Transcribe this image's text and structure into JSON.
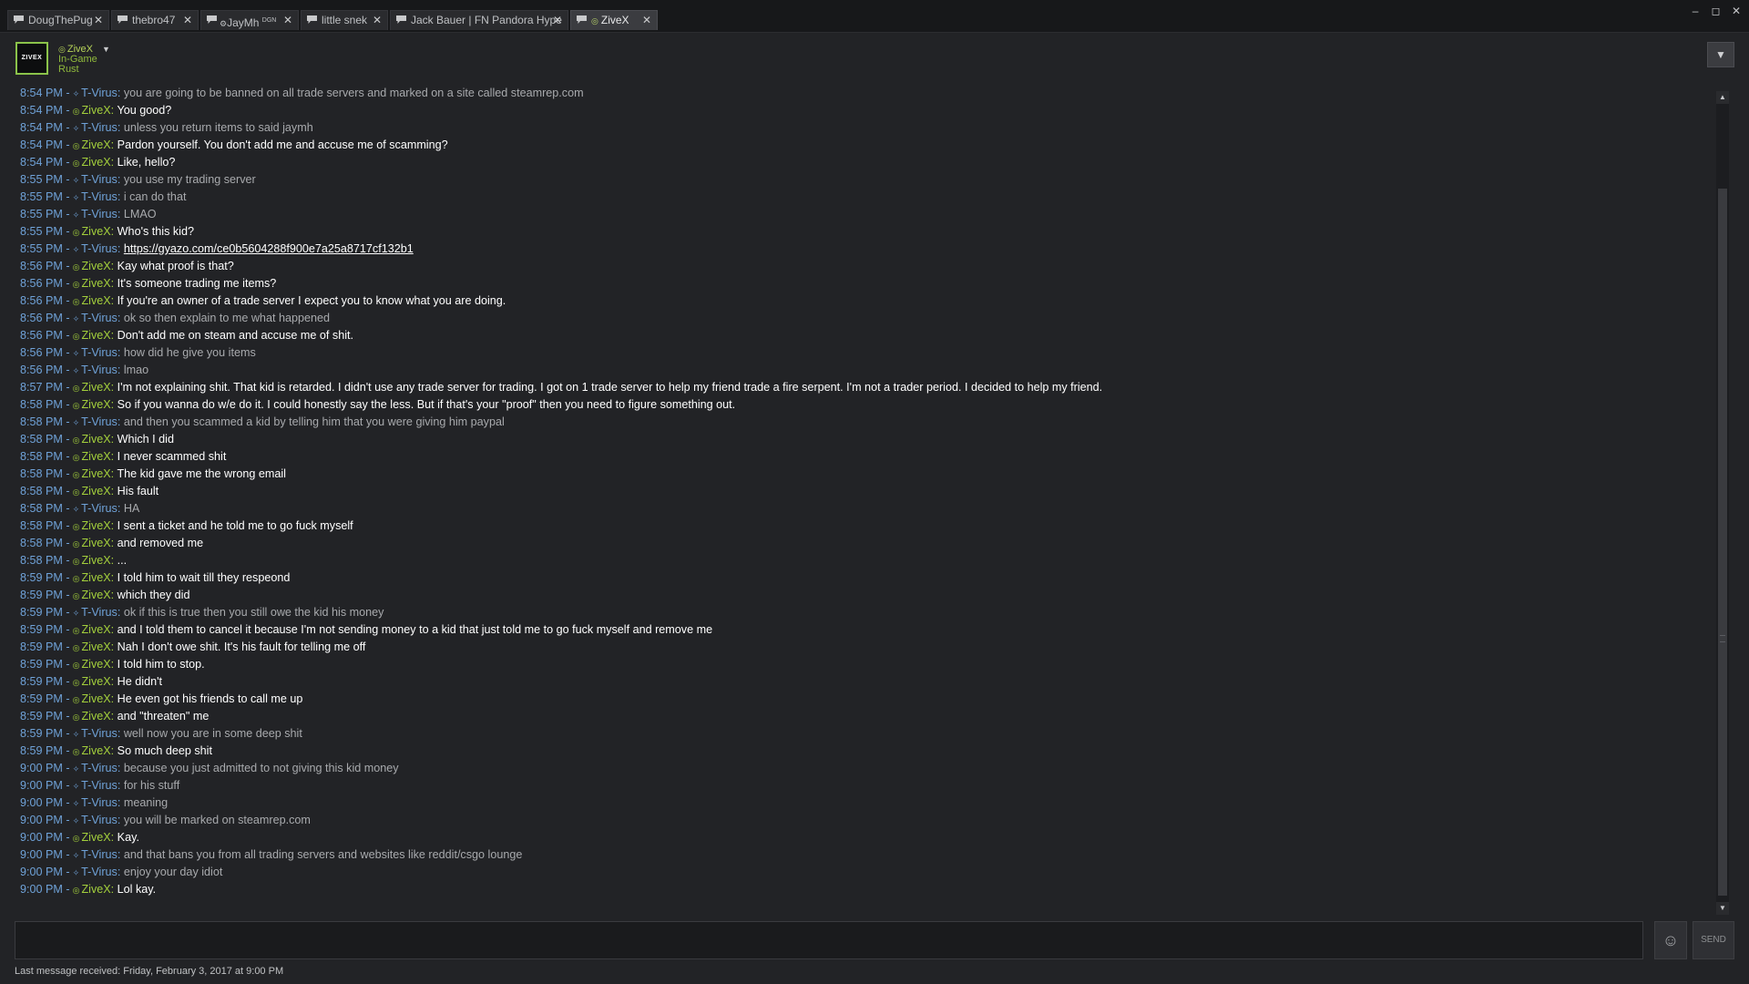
{
  "tabs": [
    {
      "label": "DougThePug",
      "active": false
    },
    {
      "label": "thebro47",
      "active": false
    },
    {
      "label": "JayMh",
      "suffix": "DGN",
      "active": false,
      "has_status": true
    },
    {
      "label": "little snek",
      "active": false
    },
    {
      "label": "Jack Bauer | FN Pandora Hype",
      "active": false
    },
    {
      "label": "ZiveX",
      "active": true,
      "has_status": true
    }
  ],
  "window_controls": {
    "minimize": "–",
    "maximize": "◻",
    "close": "✕"
  },
  "friend": {
    "avatar_text": "ZIVEX",
    "name": "ZiveX",
    "status": "In-Game",
    "game": "Rust"
  },
  "icons": {
    "tab_icon": "chat-bubble-icon",
    "status_icon": "online-status-icon",
    "t_virus_icon": "sparkle-icon",
    "scroll_up": "▲",
    "scroll_down": "▼",
    "dropdown": "▼",
    "emoticon": "☺"
  },
  "colors": {
    "timestamp": "#6fa2d8",
    "t_virus": "#6fa2d8",
    "zivex": "#a3cf3c",
    "ingame_green": "#90ba3c"
  },
  "messages": [
    {
      "time": "8:54 PM",
      "sender": "T-Virus",
      "text": "you are going to be banned on all trade servers and marked on a site called steamrep.com"
    },
    {
      "time": "8:54 PM",
      "sender": "ZiveX",
      "text": "You good?"
    },
    {
      "time": "8:54 PM",
      "sender": "T-Virus",
      "text": "unless you return items to said jaymh"
    },
    {
      "time": "8:54 PM",
      "sender": "ZiveX",
      "text": "Pardon yourself. You don't add me and accuse me of scamming?"
    },
    {
      "time": "8:54 PM",
      "sender": "ZiveX",
      "text": "Like, hello?"
    },
    {
      "time": "8:55 PM",
      "sender": "T-Virus",
      "text": "you use my trading server"
    },
    {
      "time": "8:55 PM",
      "sender": "T-Virus",
      "text": "i can do that"
    },
    {
      "time": "8:55 PM",
      "sender": "T-Virus",
      "text": "LMAO"
    },
    {
      "time": "8:55 PM",
      "sender": "ZiveX",
      "text": "Who's this kid?"
    },
    {
      "time": "8:55 PM",
      "sender": "T-Virus",
      "text": "https://gyazo.com/ce0b5604288f900e7a25a8717cf132b1",
      "link": true
    },
    {
      "time": "8:56 PM",
      "sender": "ZiveX",
      "text": "Kay what proof is that?"
    },
    {
      "time": "8:56 PM",
      "sender": "ZiveX",
      "text": "It's someone trading me items?"
    },
    {
      "time": "8:56 PM",
      "sender": "ZiveX",
      "text": "If you're an owner of a trade server I expect you to know what you are doing."
    },
    {
      "time": "8:56 PM",
      "sender": "T-Virus",
      "text": "ok so then explain to me what happened"
    },
    {
      "time": "8:56 PM",
      "sender": "ZiveX",
      "text": "Don't add me on steam and accuse me of shit."
    },
    {
      "time": "8:56 PM",
      "sender": "T-Virus",
      "text": "how did he give you items"
    },
    {
      "time": "8:56 PM",
      "sender": "T-Virus",
      "text": "lmao"
    },
    {
      "time": "8:57 PM",
      "sender": "ZiveX",
      "text": "I'm not explaining shit. That kid is retarded. I didn't use any trade server for trading. I got on 1 trade server to help my friend trade a fire serpent. I'm not a trader period. I decided to help my friend."
    },
    {
      "time": "8:58 PM",
      "sender": "ZiveX",
      "text": "So if you wanna do w/e do it. I could honestly say the less. But if that's your \"proof\" then you need to figure something out."
    },
    {
      "time": "8:58 PM",
      "sender": "T-Virus",
      "text": "and then you scammed a kid by telling him that you were giving him paypal"
    },
    {
      "time": "8:58 PM",
      "sender": "ZiveX",
      "text": "Which I did"
    },
    {
      "time": "8:58 PM",
      "sender": "ZiveX",
      "text": "I never scammed shit"
    },
    {
      "time": "8:58 PM",
      "sender": "ZiveX",
      "text": "The kid gave me the wrong email"
    },
    {
      "time": "8:58 PM",
      "sender": "ZiveX",
      "text": "His fault"
    },
    {
      "time": "8:58 PM",
      "sender": "T-Virus",
      "text": "HA"
    },
    {
      "time": "8:58 PM",
      "sender": "ZiveX",
      "text": "I sent a ticket and he told me to go fuck myself"
    },
    {
      "time": "8:58 PM",
      "sender": "ZiveX",
      "text": "and removed me"
    },
    {
      "time": "8:58 PM",
      "sender": "ZiveX",
      "text": "..."
    },
    {
      "time": "8:59 PM",
      "sender": "ZiveX",
      "text": "I told him to wait till they respeond"
    },
    {
      "time": "8:59 PM",
      "sender": "ZiveX",
      "text": "which they did"
    },
    {
      "time": "8:59 PM",
      "sender": "T-Virus",
      "text": "ok if this is true then you still owe the kid his money"
    },
    {
      "time": "8:59 PM",
      "sender": "ZiveX",
      "text": "and I told them to cancel it because I'm not sending money to a kid that just told me to go fuck myself and remove me"
    },
    {
      "time": "8:59 PM",
      "sender": "ZiveX",
      "text": "Nah I don't owe shit. It's his fault for telling me off"
    },
    {
      "time": "8:59 PM",
      "sender": "ZiveX",
      "text": "I told him to stop."
    },
    {
      "time": "8:59 PM",
      "sender": "ZiveX",
      "text": "He didn't"
    },
    {
      "time": "8:59 PM",
      "sender": "ZiveX",
      "text": "He even got his friends to call me up"
    },
    {
      "time": "8:59 PM",
      "sender": "ZiveX",
      "text": "and \"threaten\" me"
    },
    {
      "time": "8:59 PM",
      "sender": "T-Virus",
      "text": "well now you are in some deep shit"
    },
    {
      "time": "8:59 PM",
      "sender": "ZiveX",
      "text": "So much deep shit"
    },
    {
      "time": "9:00 PM",
      "sender": "T-Virus",
      "text": "because you just admitted to not giving this kid money"
    },
    {
      "time": "9:00 PM",
      "sender": "T-Virus",
      "text": "for his stuff"
    },
    {
      "time": "9:00 PM",
      "sender": "T-Virus",
      "text": "meaning"
    },
    {
      "time": "9:00 PM",
      "sender": "T-Virus",
      "text": "you will be marked on steamrep.com"
    },
    {
      "time": "9:00 PM",
      "sender": "ZiveX",
      "text": "Kay."
    },
    {
      "time": "9:00 PM",
      "sender": "T-Virus",
      "text": "and that bans you from all trading servers and websites like reddit/csgo lounge"
    },
    {
      "time": "9:00 PM",
      "sender": "T-Virus",
      "text": "enjoy your day idiot"
    },
    {
      "time": "9:00 PM",
      "sender": "ZiveX",
      "text": "Lol kay."
    }
  ],
  "input": {
    "value": "",
    "placeholder": ""
  },
  "send_label": "SEND",
  "footer": {
    "last_received": "Last message received: Friday, February 3, 2017 at 9:00 PM"
  }
}
